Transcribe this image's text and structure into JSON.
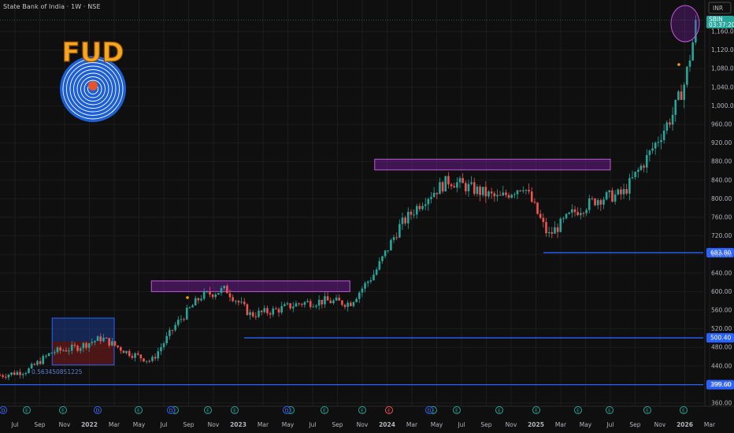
{
  "header": {
    "title": "State Bank of India · 1W · NSE"
  },
  "topright": {
    "currency": "INR",
    "symbol_tag": "SBIN",
    "countdown": "03:37:20"
  },
  "logo": {
    "text": "FUD"
  },
  "annotation": {
    "text": "0.563450851225"
  },
  "events": [
    "D",
    "E",
    "E",
    "D",
    "E",
    "DE",
    "E",
    "E",
    "DE",
    "E",
    "E",
    "E",
    "DE",
    "E",
    "E",
    "E",
    "E",
    "E",
    "E",
    "E"
  ],
  "colors": {
    "up": "#26a69a",
    "down": "#ef5350",
    "level": "#2962ff",
    "zone_fill": "#7b1fa2",
    "zone_stroke": "#c158dc",
    "rect_blue": "#2962ff",
    "bg": "#0f0f0f",
    "grid": "#1c1c1c"
  },
  "chart_data": {
    "type": "candlestick",
    "title": "State Bank of India · 1W · NSE",
    "ylim": [
      360,
      1200
    ],
    "y_ticks": [
      "360.00",
      "400.00",
      "440.00",
      "480.00",
      "520.00",
      "560.00",
      "600.00",
      "640.00",
      "680.00",
      "720.00",
      "760.00",
      "800.00",
      "840.00",
      "880.00",
      "920.00",
      "960.00",
      "1,000.00",
      "1,040.00",
      "1,080.00",
      "1,120.00",
      "1,160.00"
    ],
    "x_ticks": [
      "Jul",
      "Sep",
      "Nov",
      "2022",
      "Mar",
      "May",
      "Jul",
      "Sep",
      "Nov",
      "2023",
      "Mar",
      "May",
      "Jul",
      "Sep",
      "Nov",
      "2024",
      "Mar",
      "May",
      "Jul",
      "Sep",
      "Nov",
      "2025",
      "Mar",
      "May",
      "Jul",
      "Sep",
      "Nov",
      "2026",
      "Mar"
    ],
    "price_levels": [
      {
        "label": "683.80",
        "value": 683.8
      },
      {
        "label": "500.40",
        "value": 500.4
      },
      {
        "label": "399.60",
        "value": 399.6
      }
    ],
    "last_price": {
      "value": 1185
    },
    "supply_zones": [
      {
        "from": "2022-06",
        "to": "2023-10",
        "low": 600,
        "high": 623
      },
      {
        "from": "2023-12",
        "to": "2025-07",
        "low": 862,
        "high": 885
      }
    ],
    "consolidation_box": {
      "from": "2021-10",
      "to": "2022-03",
      "low": 442,
      "high": 543
    },
    "series_trend": [
      [
        "2021-06",
        420
      ],
      [
        "2021-08",
        430
      ],
      [
        "2021-10",
        470
      ],
      [
        "2021-12",
        480
      ],
      [
        "2022-02",
        500
      ],
      [
        "2022-04",
        470
      ],
      [
        "2022-06",
        450
      ],
      [
        "2022-08",
        530
      ],
      [
        "2022-10",
        590
      ],
      [
        "2022-12",
        605
      ],
      [
        "2023-02",
        550
      ],
      [
        "2023-04",
        560
      ],
      [
        "2023-06",
        575
      ],
      [
        "2023-08",
        580
      ],
      [
        "2023-10",
        575
      ],
      [
        "2023-12",
        640
      ],
      [
        "2024-02",
        740
      ],
      [
        "2024-04",
        800
      ],
      [
        "2024-06",
        840
      ],
      [
        "2024-08",
        820
      ],
      [
        "2024-10",
        800
      ],
      [
        "2024-12",
        830
      ],
      [
        "2025-02",
        720
      ],
      [
        "2025-04",
        770
      ],
      [
        "2025-06",
        800
      ],
      [
        "2025-08",
        810
      ],
      [
        "2025-10",
        890
      ],
      [
        "2025-12",
        980
      ],
      [
        "2026-01",
        1050
      ],
      [
        "2026-02",
        1185
      ]
    ]
  }
}
